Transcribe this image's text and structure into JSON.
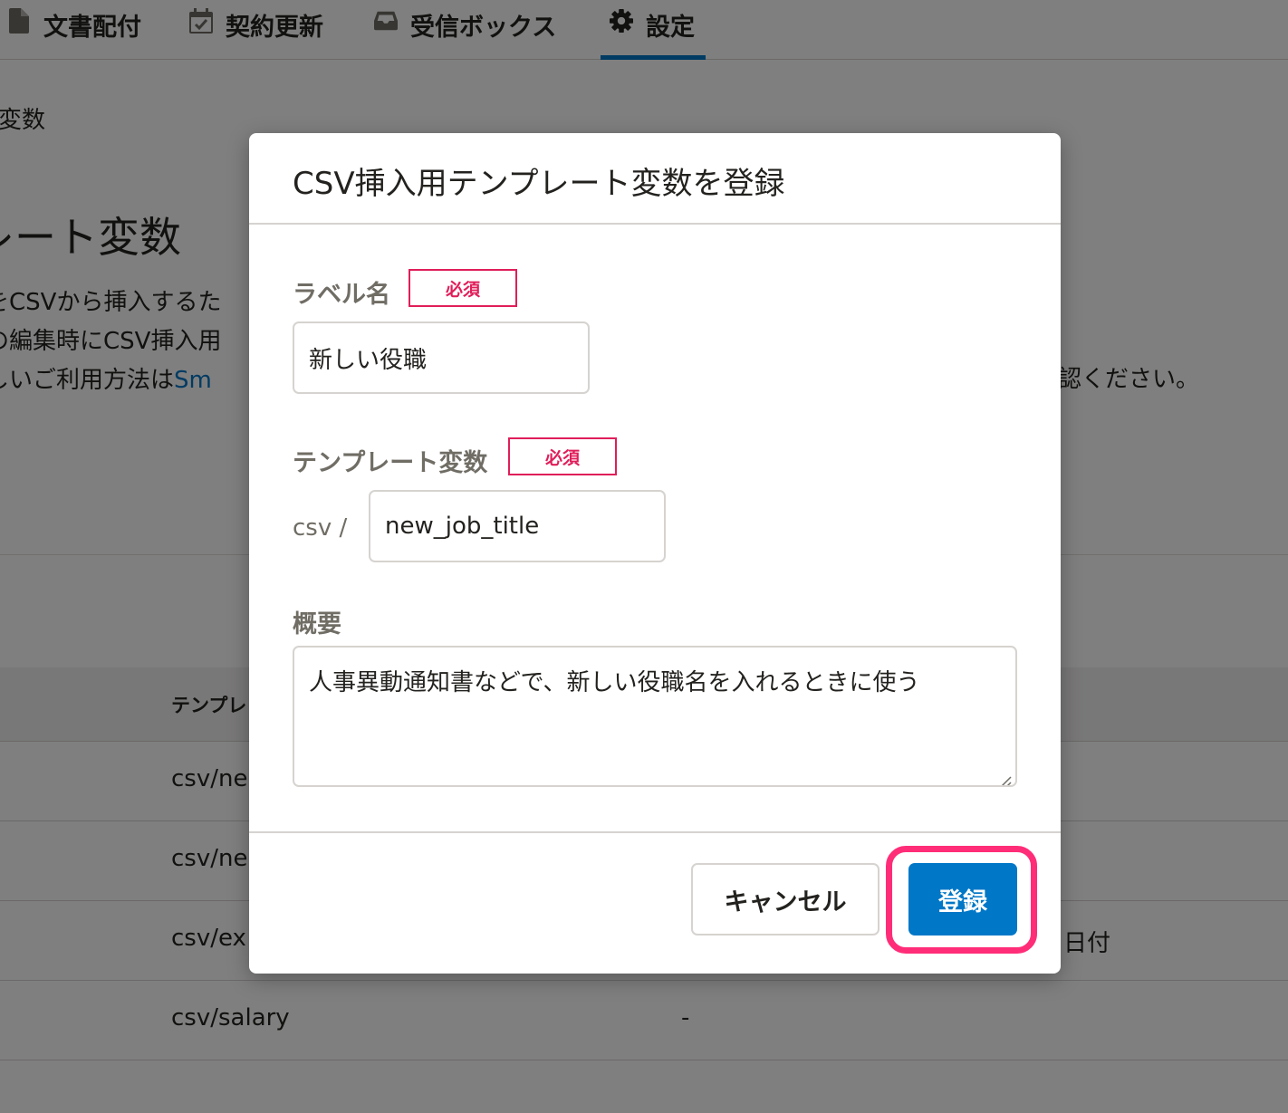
{
  "nav": {
    "tabs": [
      {
        "label": "文書配付",
        "icon": "document-icon"
      },
      {
        "label": "契約更新",
        "icon": "calendar-check-icon"
      },
      {
        "label": "受信ボックス",
        "icon": "inbox-icon"
      },
      {
        "label": "設定",
        "icon": "gear-icon",
        "active": true
      }
    ]
  },
  "background": {
    "breadcrumb": "変数",
    "heading": "レート変数",
    "desc_lines": [
      "タをCSVから挿入するた",
      "トの編集時にCSV挿入用",
      "詳しいご利用方法は"
    ],
    "desc_link": "Sm",
    "desc_tail": "認ください。",
    "table": {
      "header": "テンプレ",
      "rows": [
        {
          "variable": "csv/ne",
          "summary": "",
          "extra": ""
        },
        {
          "variable": "csv/ne",
          "summary": "",
          "extra": ""
        },
        {
          "variable": "csv/ex",
          "summary": "",
          "extra": "日付"
        },
        {
          "variable": "csv/salary",
          "summary": "-",
          "extra": ""
        }
      ]
    }
  },
  "dialog": {
    "title": "CSV挿入用テンプレート変数を登録",
    "label_field": {
      "label": "ラベル名",
      "required_badge": "必須",
      "value": "新しい役職"
    },
    "variable_field": {
      "label": "テンプレート変数",
      "required_badge": "必須",
      "prefix": "csv /",
      "value": "new_job_title"
    },
    "summary_field": {
      "label": "概要",
      "value": "人事異動通知書などで、新しい役職名を入れるときに使う"
    },
    "cancel_label": "キャンセル",
    "submit_label": "登録"
  },
  "colors": {
    "primary": "#0077c7",
    "required": "#e01e5a",
    "highlight": "#ff2d78"
  }
}
